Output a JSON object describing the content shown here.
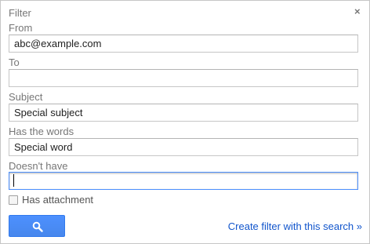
{
  "dialog": {
    "title": "Filter",
    "close_glyph": "×"
  },
  "fields": {
    "from": {
      "label": "From",
      "value": "abc@example.com"
    },
    "to": {
      "label": "To",
      "value": ""
    },
    "subject": {
      "label": "Subject",
      "value": "Special subject"
    },
    "has_words": {
      "label": "Has the words",
      "value": "Special word"
    },
    "doesnt_have": {
      "label": "Doesn't have",
      "value": ""
    }
  },
  "has_attachment": {
    "label": "Has attachment",
    "checked": false
  },
  "actions": {
    "search_icon": "search-icon",
    "create_filter": "Create filter with this search »"
  },
  "colors": {
    "accent": "#4d90fe",
    "link": "#1155cc"
  }
}
